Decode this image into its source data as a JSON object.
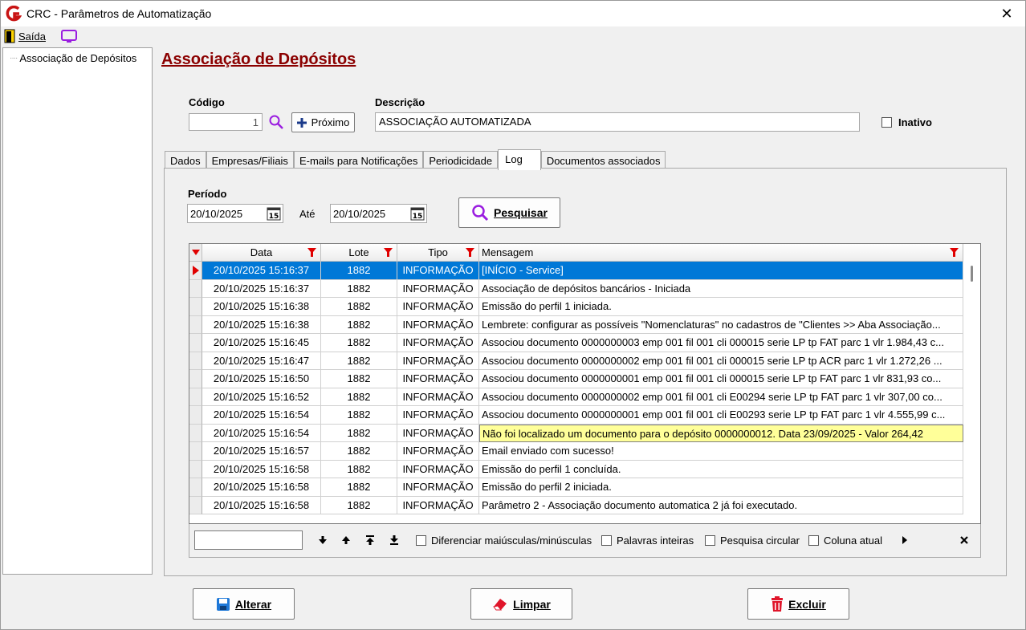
{
  "window": {
    "title": "CRC - Parâmetros de Automatização"
  },
  "menu": {
    "exit_label": "Saída"
  },
  "tree": {
    "items": [
      {
        "label": "Associação de Depósitos"
      }
    ]
  },
  "page": {
    "title": "Associação de Depósitos"
  },
  "form": {
    "codigo_label": "Código",
    "codigo_value": "1",
    "proximo_label": "Próximo",
    "descricao_label": "Descrição",
    "descricao_value": "ASSOCIAÇÃO AUTOMATIZADA",
    "inativo_label": "Inativo",
    "inativo_checked": false
  },
  "tabs": [
    {
      "label": "Dados"
    },
    {
      "label": "Empresas/Filiais"
    },
    {
      "label": "E-mails para Notificações"
    },
    {
      "label": "Periodicidade"
    },
    {
      "label": "Log",
      "active": true
    },
    {
      "label": "Documentos associados"
    }
  ],
  "log": {
    "periodo_label": "Período",
    "start_date": "20/10/2025",
    "ate_label": "Até",
    "end_date": "20/10/2025",
    "search_label": "Pesquisar",
    "columns": [
      "Data",
      "Lote",
      "Tipo",
      "Mensagem"
    ],
    "rows": [
      {
        "data": "20/10/2025 15:16:37",
        "lote": "1882",
        "tipo": "INFORMAÇÃO",
        "msg": "[INÍCIO - Service]",
        "selected": true
      },
      {
        "data": "20/10/2025 15:16:37",
        "lote": "1882",
        "tipo": "INFORMAÇÃO",
        "msg": "Associação de depósitos bancários - Iniciada"
      },
      {
        "data": "20/10/2025 15:16:38",
        "lote": "1882",
        "tipo": "INFORMAÇÃO",
        "msg": "Emissão do perfil 1 iniciada."
      },
      {
        "data": "20/10/2025 15:16:38",
        "lote": "1882",
        "tipo": "INFORMAÇÃO",
        "msg": "Lembrete: configurar as possíveis \"Nomenclaturas\" no cadastros de \"Clientes >> Aba Associação..."
      },
      {
        "data": "20/10/2025 15:16:45",
        "lote": "1882",
        "tipo": "INFORMAÇÃO",
        "msg": "Associou documento 0000000003 emp 001 fil 001 cli 000015 serie LP tp FAT parc 1 vlr 1.984,43 c..."
      },
      {
        "data": "20/10/2025 15:16:47",
        "lote": "1882",
        "tipo": "INFORMAÇÃO",
        "msg": "Associou documento 0000000002 emp 001 fil 001 cli 000015 serie LP tp ACR parc 1 vlr 1.272,26 ..."
      },
      {
        "data": "20/10/2025 15:16:50",
        "lote": "1882",
        "tipo": "INFORMAÇÃO",
        "msg": "Associou documento 0000000001 emp 001 fil 001 cli 000015 serie LP tp FAT parc 1 vlr 831,93 co..."
      },
      {
        "data": "20/10/2025 15:16:52",
        "lote": "1882",
        "tipo": "INFORMAÇÃO",
        "msg": "Associou documento 0000000002 emp 001 fil 001 cli E00294 serie LP tp FAT parc 1 vlr 307,00 co..."
      },
      {
        "data": "20/10/2025 15:16:54",
        "lote": "1882",
        "tipo": "INFORMAÇÃO",
        "msg": "Associou documento 0000000001 emp 001 fil 001 cli E00293 serie LP tp FAT parc 1 vlr 4.555,99 c..."
      },
      {
        "data": "20/10/2025 15:16:54",
        "lote": "1882",
        "tipo": "INFORMAÇÃO",
        "msg": "Não foi localizado um documento para o depósito 0000000012. Data 23/09/2025 - Valor 264,42",
        "tooltip": true
      },
      {
        "data": "20/10/2025 15:16:57",
        "lote": "1882",
        "tipo": "INFORMAÇÃO",
        "msg": "Email enviado com sucesso!"
      },
      {
        "data": "20/10/2025 15:16:58",
        "lote": "1882",
        "tipo": "INFORMAÇÃO",
        "msg": "Emissão do perfil 1 concluída."
      },
      {
        "data": "20/10/2025 15:16:58",
        "lote": "1882",
        "tipo": "INFORMAÇÃO",
        "msg": "Emissão do perfil 2 iniciada."
      },
      {
        "data": "20/10/2025 15:16:58",
        "lote": "1882",
        "tipo": "INFORMAÇÃO",
        "msg": "Parâmetro 2 - Associação documento automatica 2 já foi executado."
      }
    ]
  },
  "findbar": {
    "search_value": "",
    "options": [
      {
        "label": "Diferenciar maiúsculas/minúsculas"
      },
      {
        "label": "Palavras inteiras"
      },
      {
        "label": "Pesquisa circular"
      },
      {
        "label": "Coluna atual"
      }
    ]
  },
  "actions": {
    "alterar_label": "Alterar",
    "limpar_label": "Limpar",
    "excluir_label": "Excluir"
  },
  "colors": {
    "title_red": "#8b0000",
    "selection_blue": "#0078d7",
    "tooltip_yellow": "#ffff99",
    "filter_red": "#e00000"
  }
}
